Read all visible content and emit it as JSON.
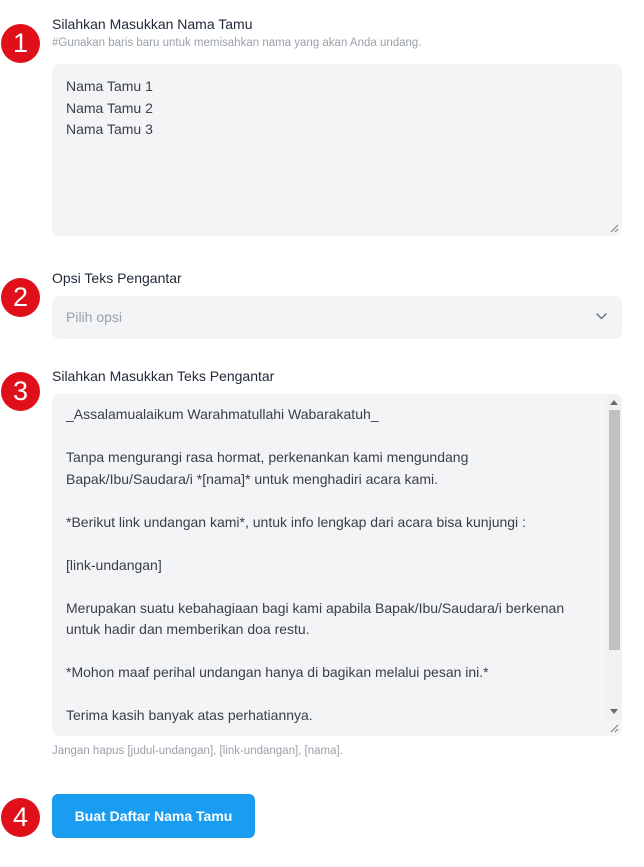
{
  "steps": [
    "1",
    "2",
    "3",
    "4"
  ],
  "guest_names": {
    "label": "Silahkan Masukkan Nama Tamu",
    "hint": "#Gunakan baris baru untuk memisahkan nama yang akan Anda undang.",
    "value": "Nama Tamu 1\nNama Tamu 2\nNama Tamu 3"
  },
  "intro_option": {
    "label": "Opsi Teks Pengantar",
    "placeholder": "Pilih opsi",
    "icon": "chevron-down-icon"
  },
  "intro_text": {
    "label": "Silahkan Masukkan Teks Pengantar",
    "value": "_Assalamualaikum Warahmatullahi Wabarakatuh_\n\nTanpa mengurangi rasa hormat, perkenankan kami mengundang Bapak/Ibu/Saudara/i *[nama]* untuk menghadiri acara kami.\n\n*Berikut link undangan kami*, untuk info lengkap dari acara bisa kunjungi :\n\n[link-undangan]\n\nMerupakan suatu kebahagiaan bagi kami apabila Bapak/Ibu/Saudara/i berkenan untuk hadir dan memberikan doa restu.\n\n*Mohon maaf perihal undangan hanya di bagikan melalui pesan ini.*\n\nTerima kasih banyak atas perhatiannya.",
    "hint": "Jangan hapus [judul-undangan], [link-undangan], [nama]."
  },
  "submit": {
    "label": "Buat Daftar Nama Tamu"
  },
  "colors": {
    "badge": "#e0101a",
    "button": "#1a9df0",
    "field_bg": "#f3f4f6",
    "hint": "#9aa0aa"
  }
}
